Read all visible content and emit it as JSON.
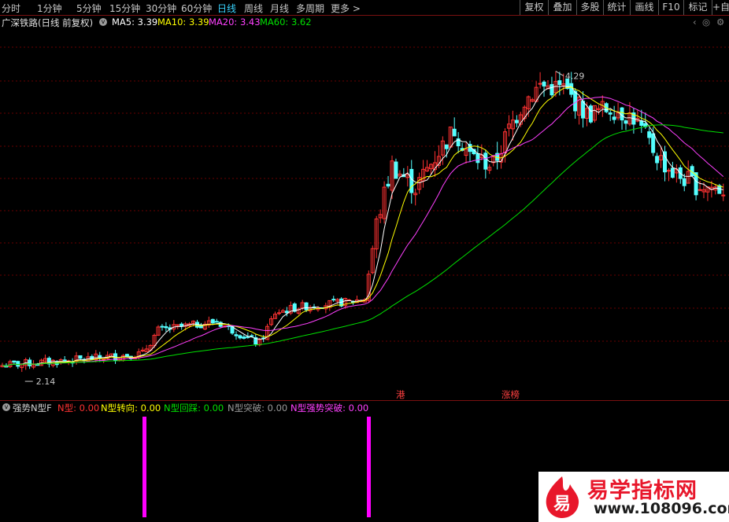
{
  "toolbar": {
    "periods": [
      "分时",
      "1分钟",
      "5分钟",
      "15分钟",
      "30分钟",
      "60分钟",
      "日线",
      "周线",
      "月线",
      "多周期"
    ],
    "active_period": "日线",
    "more": "更多",
    "right_buttons": [
      "复权",
      "叠加",
      "多股",
      "统计",
      "画线",
      "F10",
      "标记",
      "+自"
    ]
  },
  "title": {
    "stock": "广深铁路(日线 前复权)",
    "ma": [
      {
        "label": "MA5: 3.39",
        "color": "#ffffff"
      },
      {
        "label": "MA10: 3.39",
        "color": "#ffff00"
      },
      {
        "label": "MA20: 3.43",
        "color": "#ff40ff"
      },
      {
        "label": "MA60: 3.62",
        "color": "#00e000"
      }
    ]
  },
  "price_chart": {
    "ymin": 2.0,
    "ymax": 4.45,
    "high_marker": "4.29",
    "low_marker": "2.14",
    "tags": [
      "港",
      "涨榜"
    ],
    "colors": {
      "up": "#ff3232",
      "down": "#54ffff",
      "ma5": "#ffffff",
      "ma10": "#ffff00",
      "ma20": "#ff40ff",
      "ma60": "#00e000",
      "grid": "#6a0000"
    }
  },
  "indicator": {
    "name": "强势N型F",
    "fields": [
      {
        "label": "N型: 0.00",
        "color": "#ff3232"
      },
      {
        "label": "N型转向: 0.00",
        "color": "#ffff00"
      },
      {
        "label": "N型回踩: 0.00",
        "color": "#00e000"
      },
      {
        "label": "N型突破: 0.00",
        "color": "#9a9a9a"
      },
      {
        "label": "N型强势突破: 0.00",
        "color": "#ff40ff"
      }
    ],
    "signal_color": "#ff00ff"
  },
  "watermark": {
    "name": "易学指标网",
    "url": "www.108096.com",
    "mark_char": "易"
  }
}
